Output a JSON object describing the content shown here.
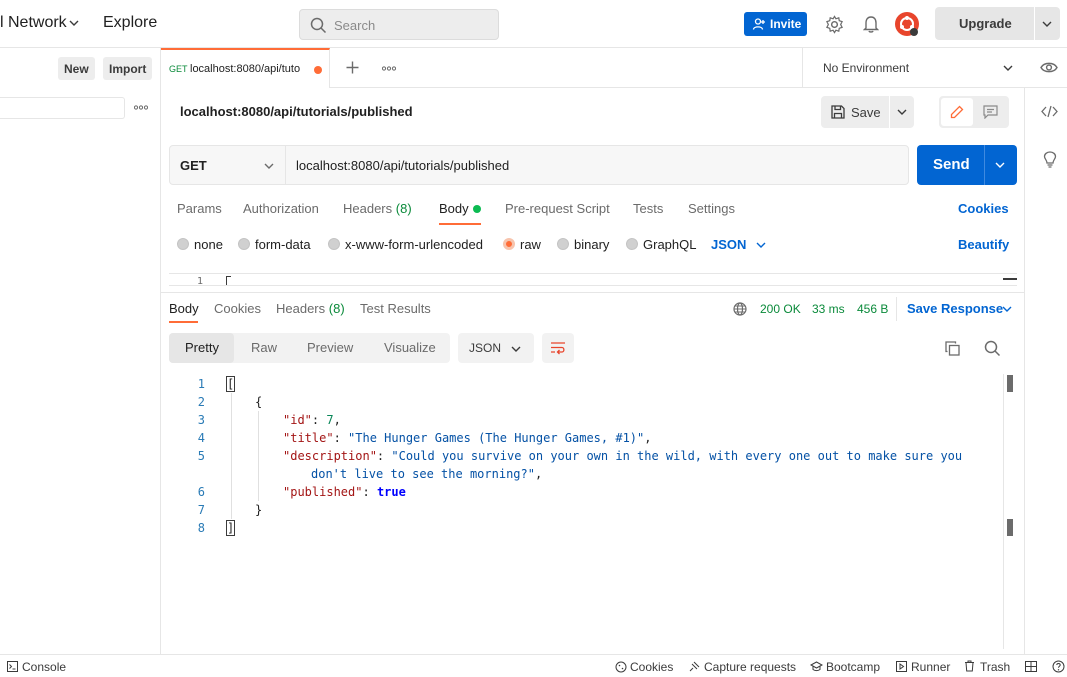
{
  "topbar": {
    "workspace": "l Network",
    "explore": "Explore",
    "search_placeholder": "Search",
    "invite_label": "Invite",
    "upgrade_label": "Upgrade"
  },
  "sidebar": {
    "new_label": "New",
    "import_label": "Import"
  },
  "tab": {
    "method": "GET",
    "title": "localhost:8080/api/tuto"
  },
  "environment": {
    "label": "No Environment"
  },
  "request": {
    "name": "localhost:8080/api/tutorials/published",
    "save_label": "Save",
    "method": "GET",
    "url": "localhost:8080/api/tutorials/published",
    "send_label": "Send",
    "tabs": {
      "params": "Params",
      "authorization": "Authorization",
      "headers": "Headers",
      "headers_count": "(8)",
      "body": "Body",
      "prerequest": "Pre-request Script",
      "tests": "Tests",
      "settings": "Settings"
    },
    "cookies_link": "Cookies",
    "body_modes": {
      "none": "none",
      "form_data": "form-data",
      "urlencoded": "x-www-form-urlencoded",
      "raw": "raw",
      "binary": "binary",
      "graphql": "GraphQL"
    },
    "raw_type": "JSON",
    "beautify": "Beautify",
    "editor_line": "1"
  },
  "response": {
    "tabs": {
      "body": "Body",
      "cookies": "Cookies",
      "headers": "Headers",
      "headers_count": "(8)",
      "test_results": "Test Results"
    },
    "status": "200 OK",
    "time": "33 ms",
    "size": "456 B",
    "save_response": "Save Response",
    "views": {
      "pretty": "Pretty",
      "raw": "Raw",
      "preview": "Preview",
      "visualize": "Visualize"
    },
    "format": "JSON",
    "line_numbers": [
      "1",
      "2",
      "3",
      "4",
      "5",
      "",
      "6",
      "7",
      "8"
    ],
    "json": {
      "open_bracket": "[",
      "open_brace": "{",
      "id_key": "\"id\"",
      "id_value": "7",
      "title_key": "\"title\"",
      "title_value": "\"The Hunger Games (The Hunger Games, #1)\"",
      "description_key": "\"description\"",
      "description_value_1": "\"Could you survive on your own in the wild, with every one out to make sure you",
      "description_value_2": "don't live to see the morning?\"",
      "published_key": "\"published\"",
      "published_value": "true",
      "close_brace": "}",
      "close_bracket": "]"
    }
  },
  "footer": {
    "console": "Console",
    "cookies": "Cookies",
    "capture": "Capture requests",
    "bootcamp": "Bootcamp",
    "runner": "Runner",
    "trash": "Trash"
  },
  "colors": {
    "accent_orange": "#ff6c37",
    "primary_blue": "#0265d2",
    "status_green": "#0a8a3a"
  }
}
